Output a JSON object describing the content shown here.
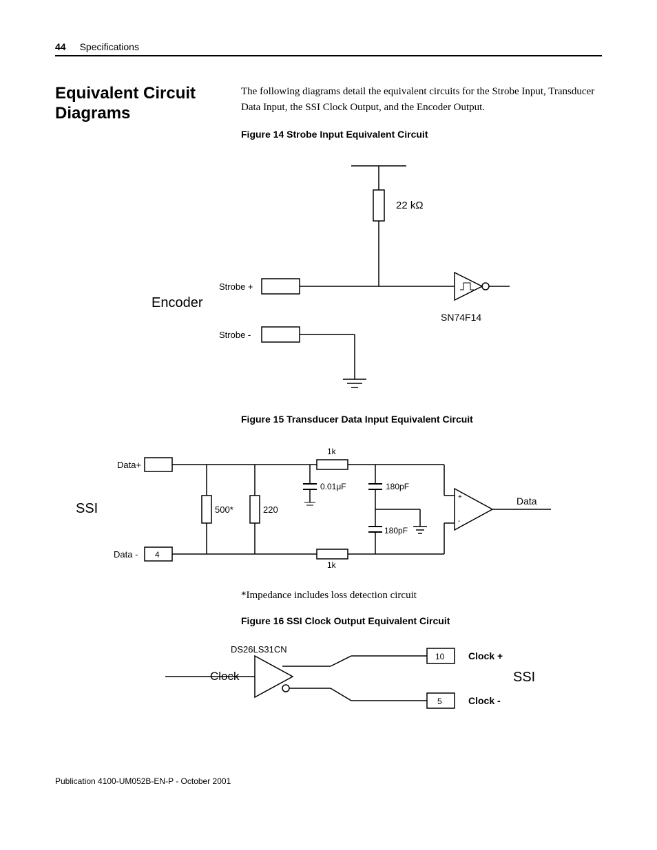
{
  "header": {
    "page_number": "44",
    "section_name": "Specifications"
  },
  "section_title": "Equivalent Circuit Diagrams",
  "intro_text": "The following diagrams detail the equivalent circuits for the Strobe Input, Transducer Data Input, the SSI Clock Output, and the Encoder Output.",
  "figures": {
    "fig14": {
      "caption": "Figure 14 Strobe Input Equivalent Circuit",
      "labels": {
        "encoder": "Encoder",
        "strobe_plus": "Strobe +",
        "strobe_minus": "Strobe -",
        "resistor": "22 kΩ",
        "chip": "SN74F14"
      }
    },
    "fig15": {
      "caption": "Figure 15 Transducer Data Input Equivalent Circuit",
      "labels": {
        "ssi": "SSI",
        "data_plus": "Data+",
        "data_minus": "Data -",
        "r1": "1k",
        "r2": "1k",
        "r3": "500*",
        "r4": "220",
        "c1": "0.01μF",
        "c2": "180pF",
        "c3": "180pF",
        "pin": "4",
        "data_out": "Data"
      },
      "note": "*Impedance includes loss detection circuit"
    },
    "fig16": {
      "caption": "Figure 16  SSI Clock Output Equivalent Circuit",
      "labels": {
        "clock": "Clock",
        "ssi": "SSI",
        "chip": "DS26LS31CN",
        "clock_plus": "Clock +",
        "clock_minus": "Clock -",
        "pin_top": "10",
        "pin_bot": "5"
      }
    }
  },
  "footer": "Publication  4100-UM052B-EN-P - October 2001"
}
